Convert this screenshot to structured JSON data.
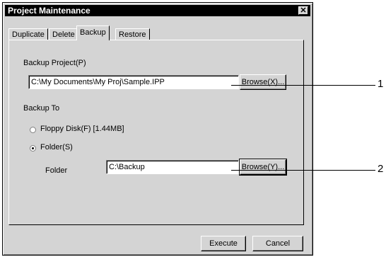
{
  "window": {
    "title": "Project Maintenance",
    "close_glyph": "✕"
  },
  "tabs": [
    {
      "label": "Duplicate",
      "active": false
    },
    {
      "label": "Delete",
      "active": false
    },
    {
      "label": "Backup",
      "active": true
    },
    {
      "label": "Restore",
      "active": false
    }
  ],
  "backup": {
    "project_label": "Backup Project(P)",
    "project_value": "C:\\My Documents\\My Proj\\Sample.IPP",
    "browse_x_label": "Browse(X)...",
    "backup_to_label": "Backup To",
    "floppy_label": "Floppy Disk(F) [1.44MB]",
    "folder_option_label": "Folder(S)",
    "folder_label": "Folder",
    "folder_value": "C:\\Backup",
    "browse_y_label": "Browse(Y)...",
    "selected_option": "folder"
  },
  "footer": {
    "execute_label": "Execute",
    "cancel_label": "Cancel"
  },
  "callouts": [
    "1",
    "2"
  ]
}
